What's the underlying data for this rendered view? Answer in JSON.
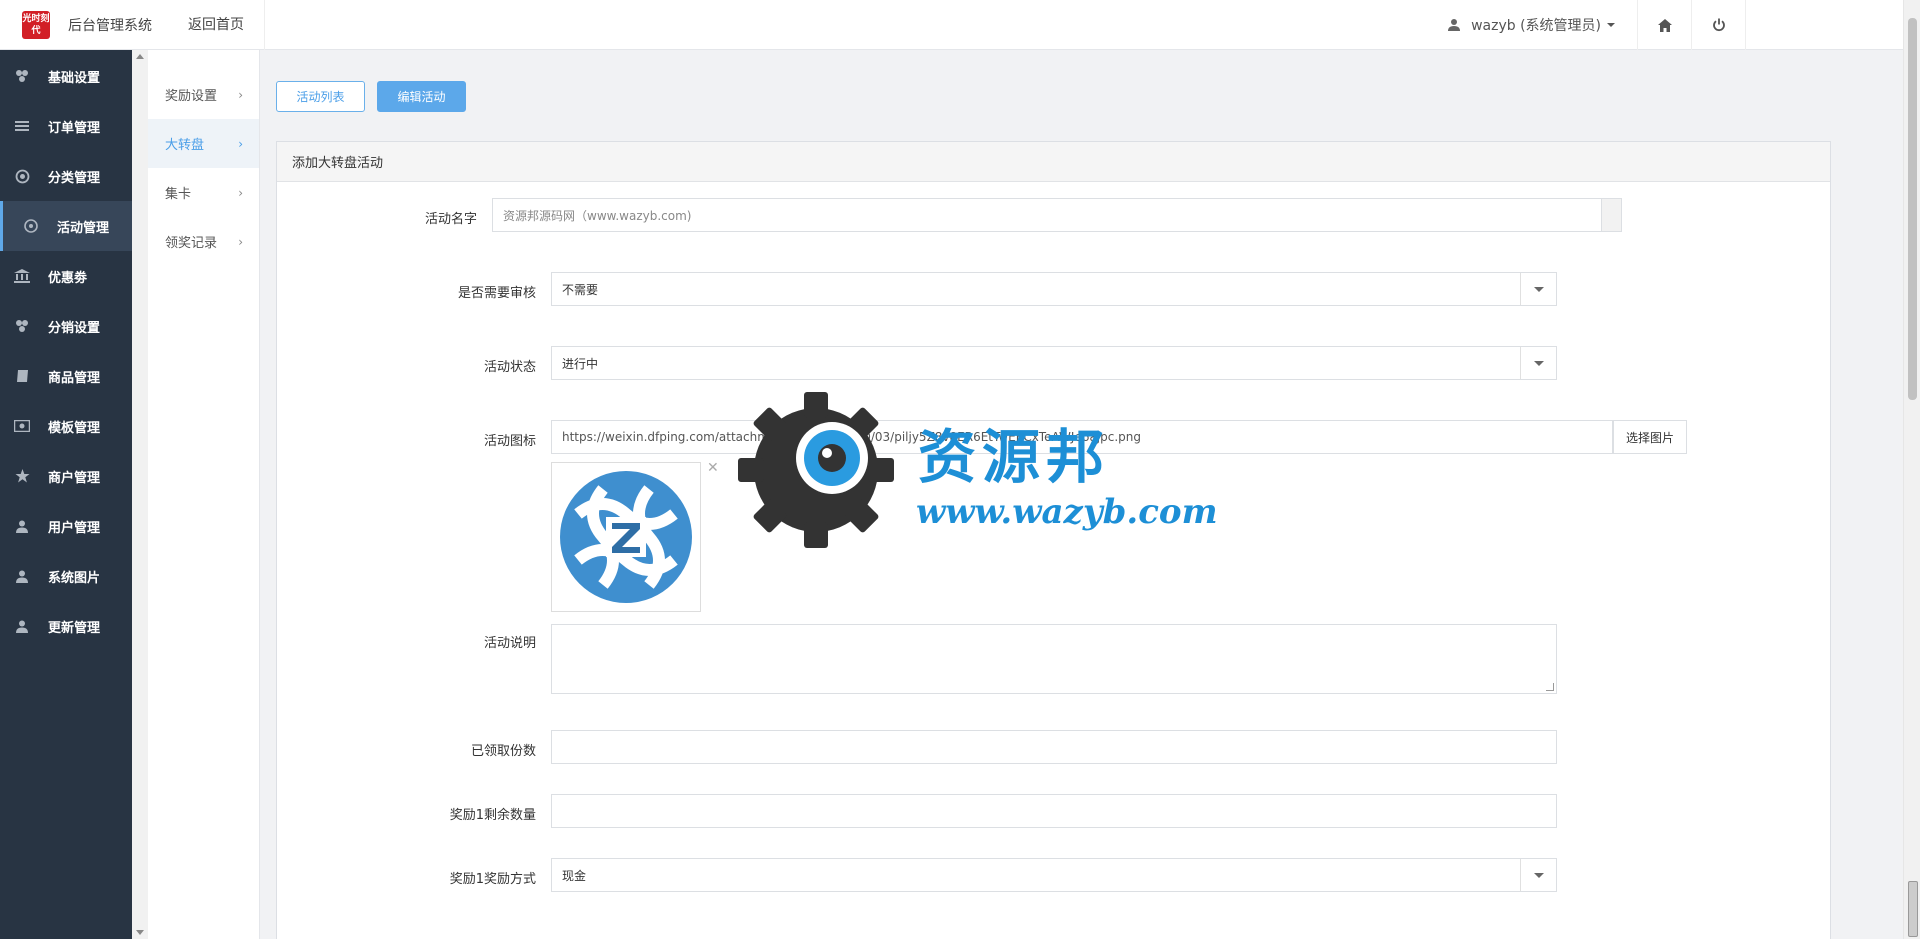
{
  "header": {
    "logo_text": "光时刻代",
    "system_title": "后台管理系统",
    "back_home": "返回首页",
    "user_label": "wazyb (系统管理员)"
  },
  "sidebar": {
    "items": [
      {
        "label": "基础设置",
        "icon": "cubes-icon"
      },
      {
        "label": "订单管理",
        "icon": "list-icon"
      },
      {
        "label": "分类管理",
        "icon": "globe-icon"
      },
      {
        "label": "活动管理",
        "icon": "compass-icon",
        "active": true
      },
      {
        "label": "优惠劵",
        "icon": "bank-icon"
      },
      {
        "label": "分销设置",
        "icon": "cubes-icon"
      },
      {
        "label": "商品管理",
        "icon": "book-icon"
      },
      {
        "label": "模板管理",
        "icon": "money-icon"
      },
      {
        "label": "商户管理",
        "icon": "star-icon"
      },
      {
        "label": "用户管理",
        "icon": "user-icon"
      },
      {
        "label": "系统图片",
        "icon": "user-icon"
      },
      {
        "label": "更新管理",
        "icon": "user-icon"
      }
    ]
  },
  "submenu": {
    "items": [
      {
        "label": "奖励设置"
      },
      {
        "label": "大转盘",
        "active": true
      },
      {
        "label": "集卡"
      },
      {
        "label": "领奖记录"
      }
    ]
  },
  "tabs": {
    "list_label": "活动列表",
    "edit_label": "编辑活动"
  },
  "panel": {
    "title": "添加大转盘活动"
  },
  "form": {
    "name_label": "活动名字",
    "name_placeholder": "资源邦源码网（www.wazyb.com)",
    "review_label": "是否需要审核",
    "review_value": "不需要",
    "status_label": "活动状态",
    "status_value": "进行中",
    "icon_label": "活动图标",
    "icon_url": "https://weixin.dfping.com/attachment/images/2020/03/piljy5Z8v8ER6EtTwEECxTeAWJe6ajpc.png",
    "pick_image": "选择图片",
    "desc_label": "活动说明",
    "received_label": "已领取份数",
    "reward1_remaining_label": "奖励1剩余数量",
    "reward1_method_label": "奖励1奖励方式",
    "reward1_method_value": "现金"
  },
  "watermark": {
    "title": "资源邦",
    "url": "www.wazyb.com"
  },
  "colors": {
    "sidebar_bg": "#283443",
    "accent": "#5ca8ea",
    "logo_red": "#d21f26"
  }
}
